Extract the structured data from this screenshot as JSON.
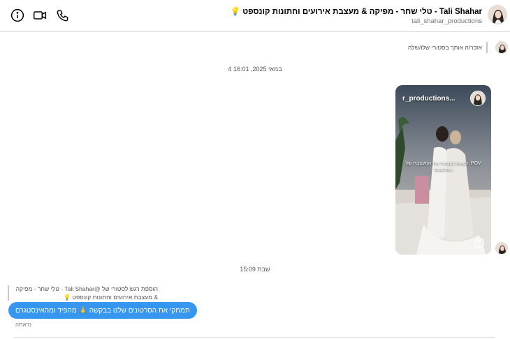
{
  "header": {
    "name": "Tali Shahar - טלי שחר - מפיקה & מעצבת אירועים וחתונות קונספט 💡",
    "handle": "tali_shahar_productions",
    "icons": [
      "info-icon",
      "video-call-icon",
      "phone-icon"
    ]
  },
  "thread": {
    "reply_note": "אזכר/ה אותך בסטורי שלו/שלה",
    "timestamp1": "4 במאי 2025, 16:01",
    "story": {
      "title": "r_productions...",
      "caption": "POV: כשאת מוצאת את המעצבת של החלומות"
    },
    "timestamp2": "שבת 15:09",
    "reaction_note": "הוספת רגש לסטורי של @Tali Shahar - טלי שחר - מפיקה & מעצבת אירועים וחתונות קונספט 💡",
    "bubble_text": "תמחקי את הסרטונים שלנו בבקשה 🙏 מהפיד ומהאינסטגרם",
    "seen": "נראתה"
  },
  "colors": {
    "accent": "#3797f0",
    "divider": "#dbdbdb"
  }
}
